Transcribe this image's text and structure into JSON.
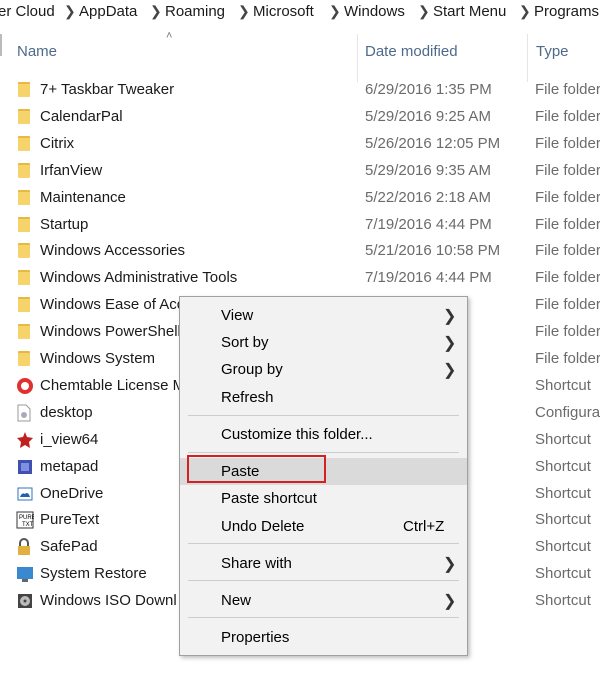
{
  "breadcrumb": [
    "er Cloud",
    "AppData",
    "Roaming",
    "Microsoft",
    "Windows",
    "Start Menu",
    "Programs"
  ],
  "columns": {
    "name": "Name",
    "date": "Date modified",
    "type": "Type"
  },
  "files": [
    {
      "name": "7+ Taskbar Tweaker",
      "date": "6/29/2016 1:35 PM",
      "type": "File folder",
      "icon": "folder-icon"
    },
    {
      "name": "CalendarPal",
      "date": "5/29/2016 9:25 AM",
      "type": "File folder",
      "icon": "folder-icon"
    },
    {
      "name": "Citrix",
      "date": "5/26/2016 12:05 PM",
      "type": "File folder",
      "icon": "folder-icon"
    },
    {
      "name": "IrfanView",
      "date": "5/29/2016 9:35 AM",
      "type": "File folder",
      "icon": "folder-icon"
    },
    {
      "name": "Maintenance",
      "date": "5/22/2016 2:18 AM",
      "type": "File folder",
      "icon": "folder-icon"
    },
    {
      "name": "Startup",
      "date": "7/19/2016 4:44 PM",
      "type": "File folder",
      "icon": "folder-icon"
    },
    {
      "name": "Windows Accessories",
      "date": "5/21/2016 10:58 PM",
      "type": "File folder",
      "icon": "folder-icon"
    },
    {
      "name": "Windows Administrative Tools",
      "date": "7/19/2016 4:44 PM",
      "type": "File folder",
      "icon": "folder-icon"
    },
    {
      "name": "Windows Ease of Acc",
      "date": "AM",
      "type": "File folder",
      "icon": "folder-icon"
    },
    {
      "name": "Windows PowerShell",
      "date": "AM",
      "type": "File folder",
      "icon": "folder-icon"
    },
    {
      "name": "Windows System",
      "date": "AM",
      "type": "File folder",
      "icon": "folder-icon"
    },
    {
      "name": "Chemtable License M",
      "date": "7 AM",
      "type": "Shortcut",
      "icon": "chemtable-icon"
    },
    {
      "name": "desktop",
      "date": "PM",
      "type": "Configura",
      "icon": "config-file-icon"
    },
    {
      "name": "i_view64",
      "date": "1 PM",
      "type": "Shortcut",
      "icon": "irfanview-icon"
    },
    {
      "name": "metapad",
      "date": "2 AM",
      "type": "Shortcut",
      "icon": "metapad-icon"
    },
    {
      "name": "OneDrive",
      "date": "4 PM",
      "type": "Shortcut",
      "icon": "onedrive-icon"
    },
    {
      "name": "PureText",
      "date": "0 AM",
      "type": "Shortcut",
      "icon": "puretext-icon"
    },
    {
      "name": "SafePad",
      "date": "PM",
      "type": "Shortcut",
      "icon": "lock-icon"
    },
    {
      "name": "System Restore",
      "date": "AM",
      "type": "Shortcut",
      "icon": "system-restore-icon"
    },
    {
      "name": "Windows ISO Downl",
      "date": "0 PM",
      "type": "Shortcut",
      "icon": "disc-icon"
    }
  ],
  "context_menu": {
    "view": "View",
    "sort_by": "Sort by",
    "group_by": "Group by",
    "refresh": "Refresh",
    "customize": "Customize this folder...",
    "paste": "Paste",
    "paste_shortcut": "Paste shortcut",
    "undo_delete": "Undo Delete",
    "undo_shortcut": "Ctrl+Z",
    "share_with": "Share with",
    "new": "New",
    "properties": "Properties"
  },
  "colors": {
    "highlight_box": "#d42020",
    "folder": "#f7d36b",
    "header_text": "#4d6a8a"
  }
}
